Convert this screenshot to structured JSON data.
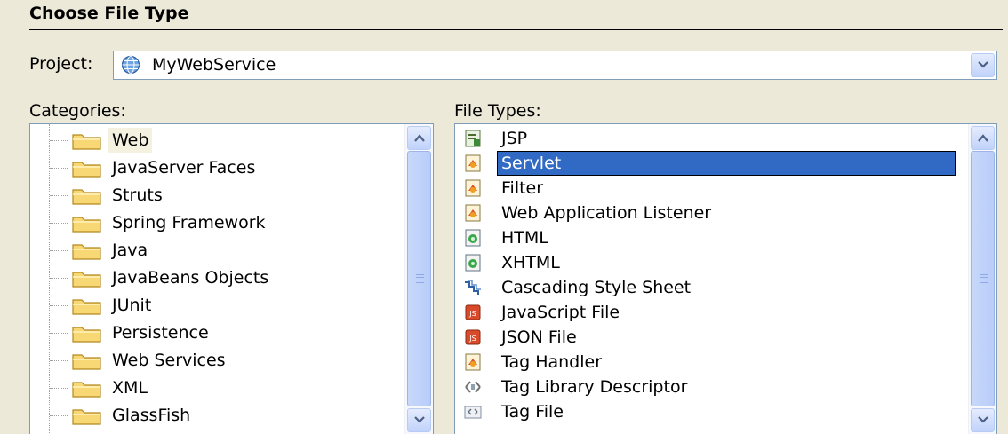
{
  "header": {
    "title": "Choose File Type"
  },
  "project": {
    "label": "Project:",
    "value": "MyWebService"
  },
  "categories": {
    "label": "Categories:",
    "items": [
      "Web",
      "JavaServer Faces",
      "Struts",
      "Spring Framework",
      "Java",
      "JavaBeans Objects",
      "JUnit",
      "Persistence",
      "Web Services",
      "XML",
      "GlassFish"
    ],
    "selected": "Web"
  },
  "file_types": {
    "label": "File Types:",
    "items": [
      "JSP",
      "Servlet",
      "Filter",
      "Web Application Listener",
      "HTML",
      "XHTML",
      "Cascading Style Sheet",
      "JavaScript File",
      "JSON File",
      "Tag Handler",
      "Tag Library Descriptor",
      "Tag File"
    ],
    "selected": "Servlet",
    "icons": [
      "jsp-icon",
      "servlet-icon",
      "filter-icon",
      "listener-icon",
      "html-icon",
      "xhtml-icon",
      "css-icon",
      "js-icon",
      "json-icon",
      "tag-handler-icon",
      "tld-icon",
      "tag-file-icon"
    ]
  },
  "colors": {
    "selection": "#316ac5",
    "background": "#ece9d8",
    "border": "#7f9db9"
  }
}
